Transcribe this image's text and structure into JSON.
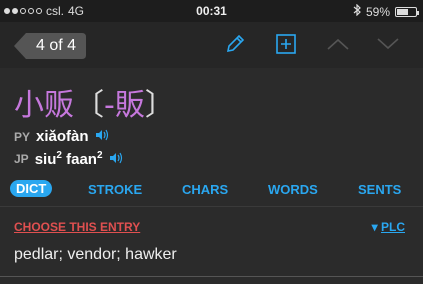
{
  "status_bar": {
    "carrier": "csl.",
    "network": "4G",
    "time": "00:31",
    "battery": "59%",
    "battery_level": 0.59
  },
  "nav": {
    "back_label": "4 of 4",
    "icons": [
      "pencil-icon",
      "add-square-icon",
      "chevron-up-icon",
      "chevron-down-icon"
    ]
  },
  "entry": {
    "simplified": "小贩",
    "bracket_open": "〔",
    "traditional": "-販",
    "bracket_close": "〕",
    "py_label": "PY",
    "pinyin": "xiǎofàn",
    "jp_label": "JP",
    "jyutping_1": "siu",
    "jyutping_1_tone": "2",
    "jyutping_2": "faan",
    "jyutping_2_tone": "2"
  },
  "tabs": [
    "DICT",
    "STROKE",
    "CHARS",
    "WORDS",
    "SENTS"
  ],
  "choose_label": "CHOOSE THIS ENTRY",
  "plc_label": "PLC",
  "definition": "pedlar; vendor; hawker",
  "colors": {
    "accent": "#2aa7f0",
    "hanzi": "#c678dd",
    "choose": "#e05050"
  }
}
